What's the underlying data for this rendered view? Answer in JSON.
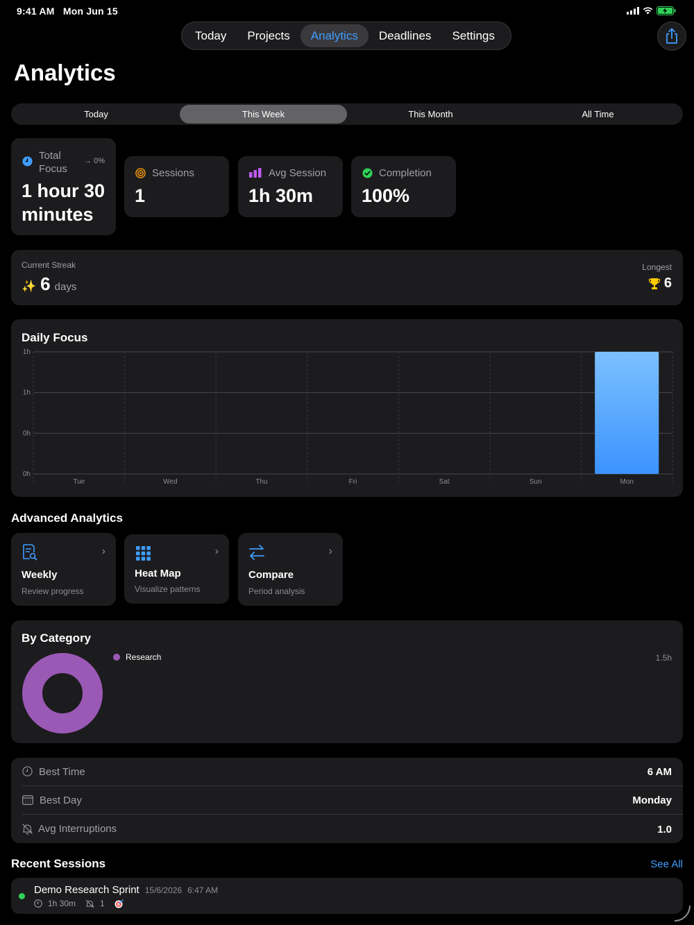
{
  "status_bar": {
    "time": "9:41 AM",
    "date": "Mon Jun 15"
  },
  "nav": {
    "tabs": [
      {
        "label": "Today",
        "active": false
      },
      {
        "label": "Projects",
        "active": false
      },
      {
        "label": "Analytics",
        "active": true
      },
      {
        "label": "Deadlines",
        "active": false
      },
      {
        "label": "Settings",
        "active": false
      }
    ],
    "share_icon": "share-icon"
  },
  "page": {
    "title": "Analytics"
  },
  "period": {
    "options": [
      "Today",
      "This Week",
      "This Month",
      "All Time"
    ],
    "selected": "This Week"
  },
  "stats": {
    "total": {
      "label_line1": "Total",
      "label_line2": "Focus",
      "change": "0%",
      "value_line1": "1 hour 30",
      "value_line2": "minutes"
    },
    "sessions": {
      "label": "Sessions",
      "value": "1"
    },
    "avg": {
      "label": "Avg Session",
      "value": "1h 30m"
    },
    "completion": {
      "label": "Completion",
      "value": "100%"
    }
  },
  "streak": {
    "label": "Current Streak",
    "value": "6",
    "unit": "days",
    "longest_label": "Longest",
    "longest_value": "6"
  },
  "chart": {
    "title": "Daily Focus",
    "ytick_labels": [
      "1h",
      "1h",
      "0h",
      "0h"
    ]
  },
  "chart_data": {
    "type": "bar",
    "title": "Daily Focus",
    "categories": [
      "Tue",
      "Wed",
      "Thu",
      "Fri",
      "Sat",
      "Sun",
      "Mon"
    ],
    "values": [
      0,
      0,
      0,
      0,
      0,
      0,
      1.5
    ],
    "ylim": [
      0,
      1.5
    ],
    "yunit": "hours",
    "ytick_labels": [
      "1h",
      "1h",
      "0h",
      "0h"
    ],
    "grid": true,
    "bar_color": "#409cff"
  },
  "advanced": {
    "title": "Advanced Analytics",
    "cards": [
      {
        "title": "Weekly",
        "subtitle": "Review progress",
        "icon": "report-icon"
      },
      {
        "title": "Heat Map",
        "subtitle": "Visualize patterns",
        "icon": "grid-icon"
      },
      {
        "title": "Compare",
        "subtitle": "Period analysis",
        "icon": "arrows-icon"
      }
    ]
  },
  "category": {
    "title": "By Category",
    "items": [
      {
        "name": "Research",
        "value": "1.5h",
        "share": 1.0,
        "color": "#9b59b6"
      }
    ]
  },
  "insights": {
    "rows": [
      {
        "label": "Best Time",
        "value": "6 AM",
        "icon": "clock-icon"
      },
      {
        "label": "Best Day",
        "value": "Monday",
        "icon": "calendar-icon"
      },
      {
        "label": "Avg Interruptions",
        "value": "1.0",
        "icon": "bell-slash-icon"
      }
    ]
  },
  "recent": {
    "title": "Recent Sessions",
    "see_all": "See All",
    "sessions": [
      {
        "name": "Demo Research Sprint",
        "date": "15/6/2026",
        "time": "6:47 AM",
        "duration": "1h 30m",
        "interruptions": "1",
        "status_color": "#30d158"
      }
    ]
  },
  "colors": {
    "accent": "#409cff",
    "card": "#1c1c1e",
    "background": "#000000"
  }
}
